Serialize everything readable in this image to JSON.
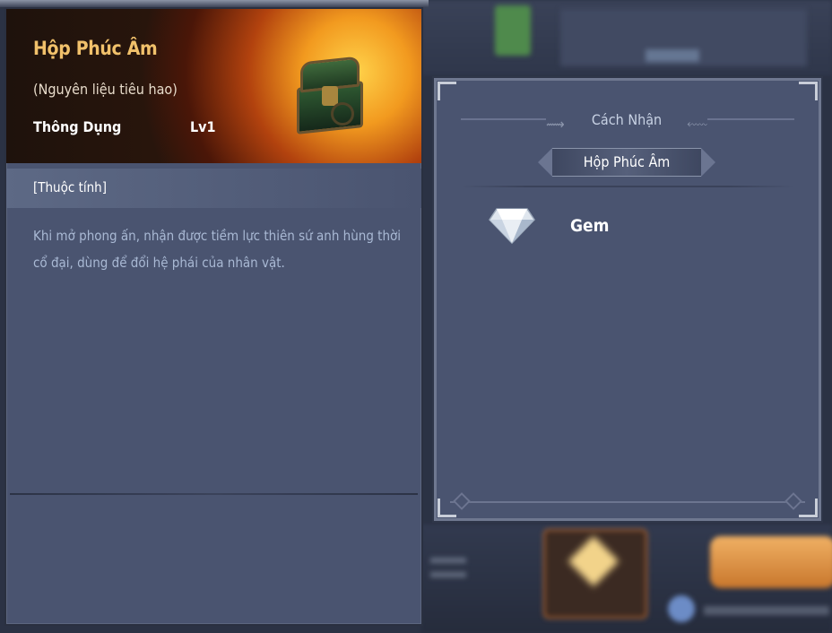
{
  "item": {
    "name": "Hộp Phúc Âm",
    "subtitle": "(Nguyên liệu tiêu hao)",
    "rarity": "Thông Dụng",
    "level": "Lv1",
    "icon": "treasure-chest-icon",
    "attribute_header": "[Thuộc tính]",
    "description": "Khi mở phong ấn, nhận được tiềm lực thiên sứ anh hùng thời cổ đại, dùng để đổi hệ phái của nhân vật."
  },
  "source": {
    "title": "Cách Nhận",
    "item_name": "Hộp Phúc Âm",
    "entries": [
      {
        "label": "Gem",
        "icon": "gem-icon"
      }
    ]
  },
  "colors": {
    "item_name": "#f1c16b",
    "description": "#a9b9d4",
    "panel": "#4a5470"
  }
}
